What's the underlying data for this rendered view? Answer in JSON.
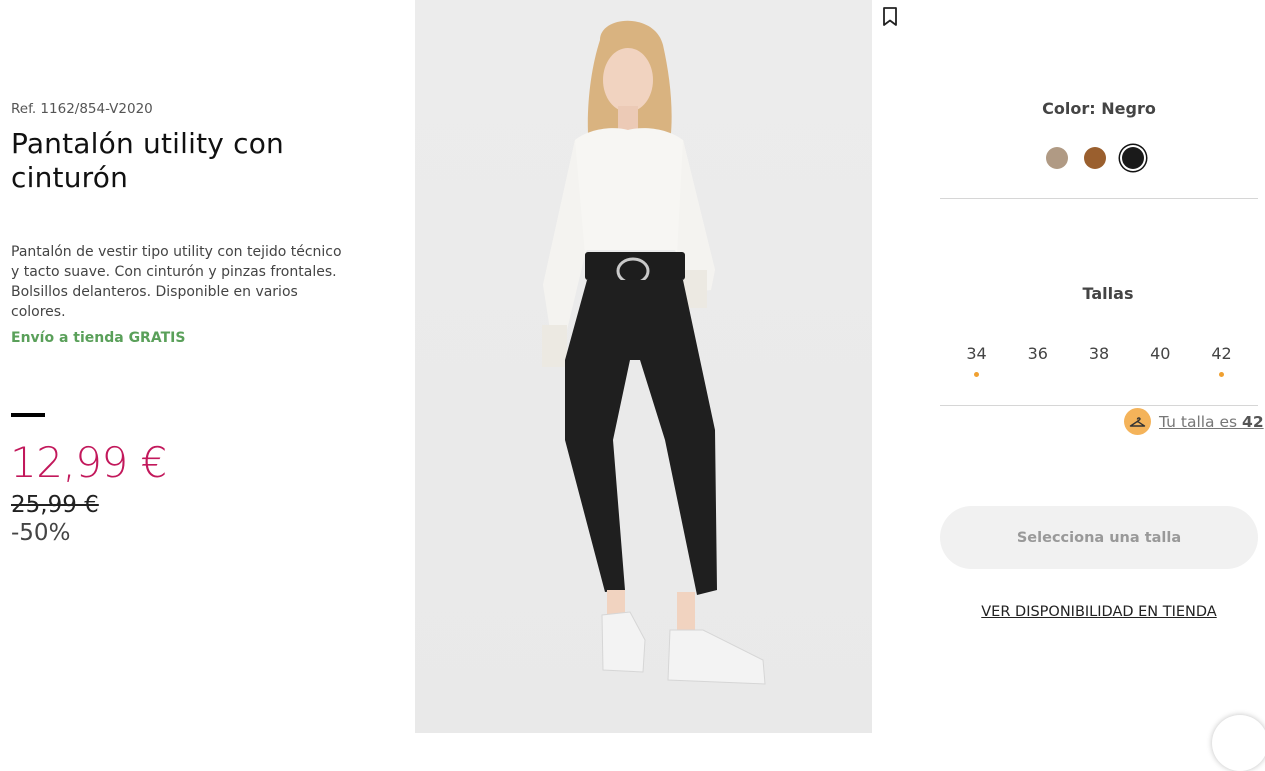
{
  "product": {
    "ref": "Ref. 1162/854-V2020",
    "title": "Pantalón utility con cinturón",
    "description": "Pantalón de vestir tipo utility con tejido técnico y tacto suave. Con cinturón y pinzas frontales. Bolsillos delanteros. Disponible en varios colores.",
    "shipping": "Envío a tienda GRATIS",
    "price": "12,99 €",
    "old_price": "25,99 €",
    "discount": "-50%",
    "image_alt": "model-wearing-black-utility-trousers"
  },
  "colors": {
    "label": "Color: Negro",
    "options": [
      {
        "name": "beige",
        "hex": "#b09a84"
      },
      {
        "name": "brown",
        "hex": "#9a5f2e"
      },
      {
        "name": "black",
        "hex": "#1a1a1a",
        "selected": true
      }
    ]
  },
  "sizes": {
    "label": "Tallas",
    "options": [
      {
        "label": "34",
        "low_stock": true
      },
      {
        "label": "36",
        "low_stock": false
      },
      {
        "label": "38",
        "low_stock": false
      },
      {
        "label": "40",
        "low_stock": false
      },
      {
        "label": "42",
        "low_stock": true
      }
    ]
  },
  "size_advisor": {
    "prefix": "Tu talla es ",
    "size": "42"
  },
  "actions": {
    "select_size": "Selecciona una talla",
    "store_availability": "VER DISPONIBILIDAD EN TIENDA"
  },
  "icons": {
    "bookmark": "bookmark-icon",
    "hanger": "hanger-icon"
  },
  "theme": {
    "price_color": "#c2185b",
    "shipping_color": "#5aa05a",
    "low_stock_dot": "#f0a030",
    "advisor_badge": "#f4b35a"
  }
}
